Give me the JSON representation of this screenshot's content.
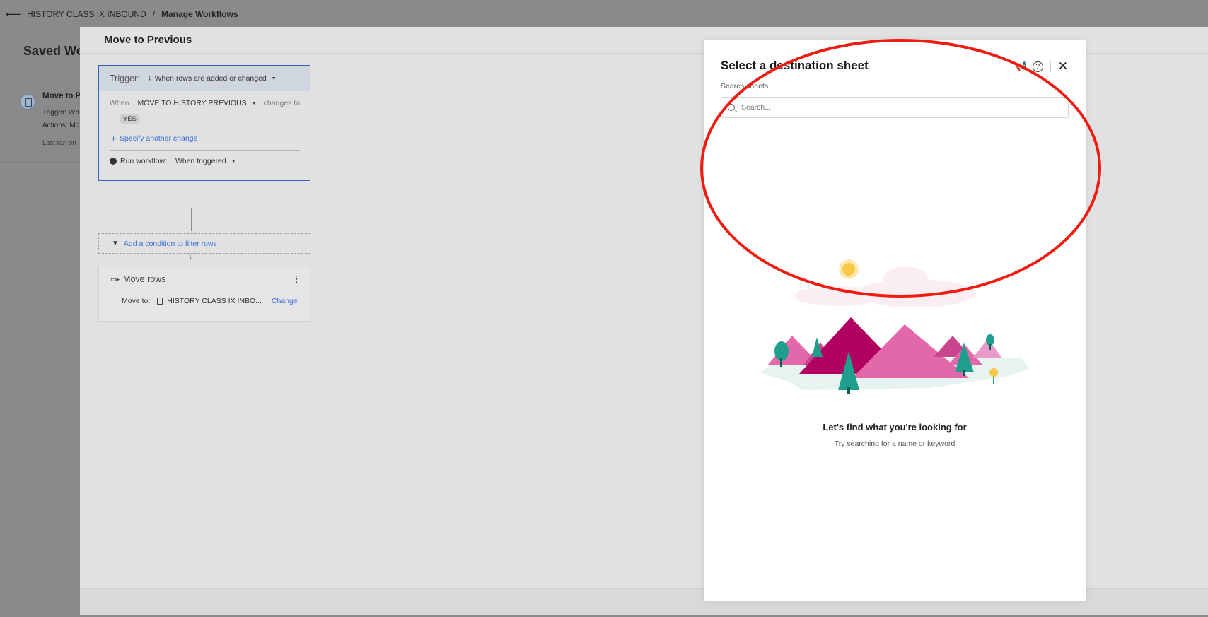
{
  "topbar": {
    "breadcrumb_sheet": "HISTORY CLASS IX INBOUND",
    "separator": "/",
    "breadcrumb_current": "Manage Workflows"
  },
  "background": {
    "title": "Saved Wo",
    "card": {
      "name": "Move to P",
      "trigger_line": "Trigger: Wh",
      "actions_line": "Actions: Mc",
      "last_ran": "Last ran on"
    }
  },
  "editor": {
    "title": "Move to Previous",
    "trigger": {
      "label": "Trigger:",
      "type": "When rows are added or changed",
      "when_label": "When",
      "column": "MOVE TO HISTORY PREVIOUS",
      "changes_to": "changes to:",
      "value": "YES",
      "specify_another": "Specify another change",
      "run_label": "Run workflow:",
      "run_value": "When triggered"
    },
    "condition_label": "Add a condition to filter rows",
    "action": {
      "title": "Move rows",
      "move_to_label": "Move to:",
      "sheet": "HISTORY CLASS IX INBO...",
      "change": "Change"
    }
  },
  "panel": {
    "title": "Select a destination sheet",
    "search_label": "Search sheets",
    "search_placeholder": "Search...",
    "empty_title": "Let's find what you're looking for",
    "empty_subtitle": "Try searching for a name or keyword",
    "icons": [
      "megaphone-icon",
      "help-icon",
      "close-icon"
    ]
  },
  "colors": {
    "accent": "#3a6fd8",
    "annotation": "#f21b0f",
    "mountain_pink": "#e268a9",
    "mountain_magenta": "#b1005f",
    "tree_teal": "#1f9e8e",
    "sun": "#f7c948"
  }
}
